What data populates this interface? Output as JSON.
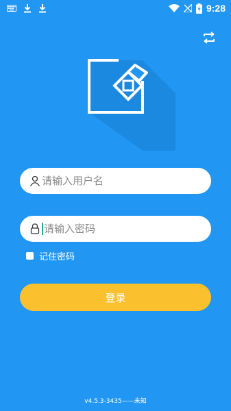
{
  "status_bar": {
    "time": "9:28",
    "icons": [
      "keyboard-icon",
      "download-icon",
      "download-icon",
      "wifi-icon",
      "no-sim-icon",
      "battery-charging-icon"
    ]
  },
  "header": {
    "switch_icon": "swap-icon"
  },
  "logo": {
    "icon": "app-logo"
  },
  "form": {
    "username_placeholder": "请输入用户名",
    "username_value": "",
    "password_placeholder": "请输入密码",
    "password_value": "",
    "remember_label": "记住密码",
    "remember_checked": false,
    "login_label": "登录"
  },
  "footer": {
    "version": "v4.5.3-3435——未知"
  },
  "colors": {
    "background": "#2196f3",
    "button": "#fbc02d",
    "field": "#ffffff",
    "logo_shadow": "#1a7fd0"
  }
}
